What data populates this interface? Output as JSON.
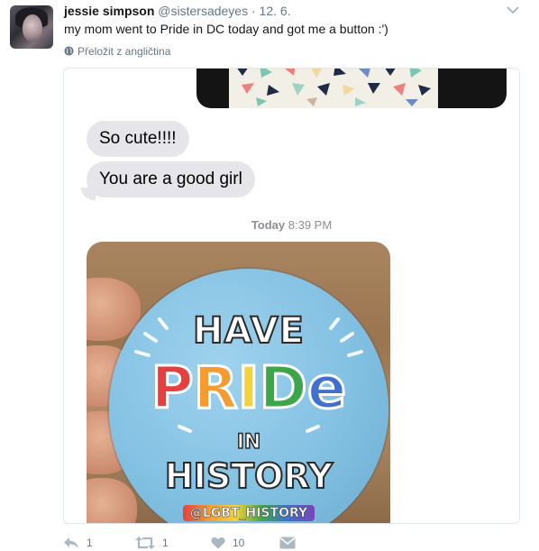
{
  "tweet": {
    "author_name": "jessie simpson",
    "handle": "@sistersadeyes",
    "separator": "·",
    "date": "12. 6.",
    "text": "my mom went to Pride in DC today and got me a button :')",
    "translate_label": "Přeložit z angličtina"
  },
  "media": {
    "messages": [
      {
        "text": "So cute!!!!"
      },
      {
        "text": "You are a good girl"
      }
    ],
    "timestamp_day": "Today",
    "timestamp_time": "8:39 PM",
    "pin": {
      "line1": "HAVE",
      "pride_letters": [
        "P",
        "R",
        "I",
        "D",
        "e"
      ],
      "pride_colors": [
        "#e5403d",
        "#f59b32",
        "#f5d23a",
        "#3ea64a",
        "#3f6fcf"
      ],
      "line3": "IN",
      "line4": "HISTORY",
      "handle": "@LGBT_HISTORY"
    }
  },
  "actions": {
    "reply_count": "1",
    "retweet_count": "1",
    "like_count": "10"
  },
  "icons": {
    "avatar": "user-avatar",
    "chevron": "chevron-down-icon",
    "globe": "globe-icon",
    "reply": "reply-icon",
    "retweet": "retweet-icon",
    "like": "heart-icon",
    "dm": "direct-message-icon"
  },
  "colors": {
    "secondary_text": "#657786",
    "bubble_gray": "#e5e5ea",
    "pin_blue": "#82c0e2"
  }
}
